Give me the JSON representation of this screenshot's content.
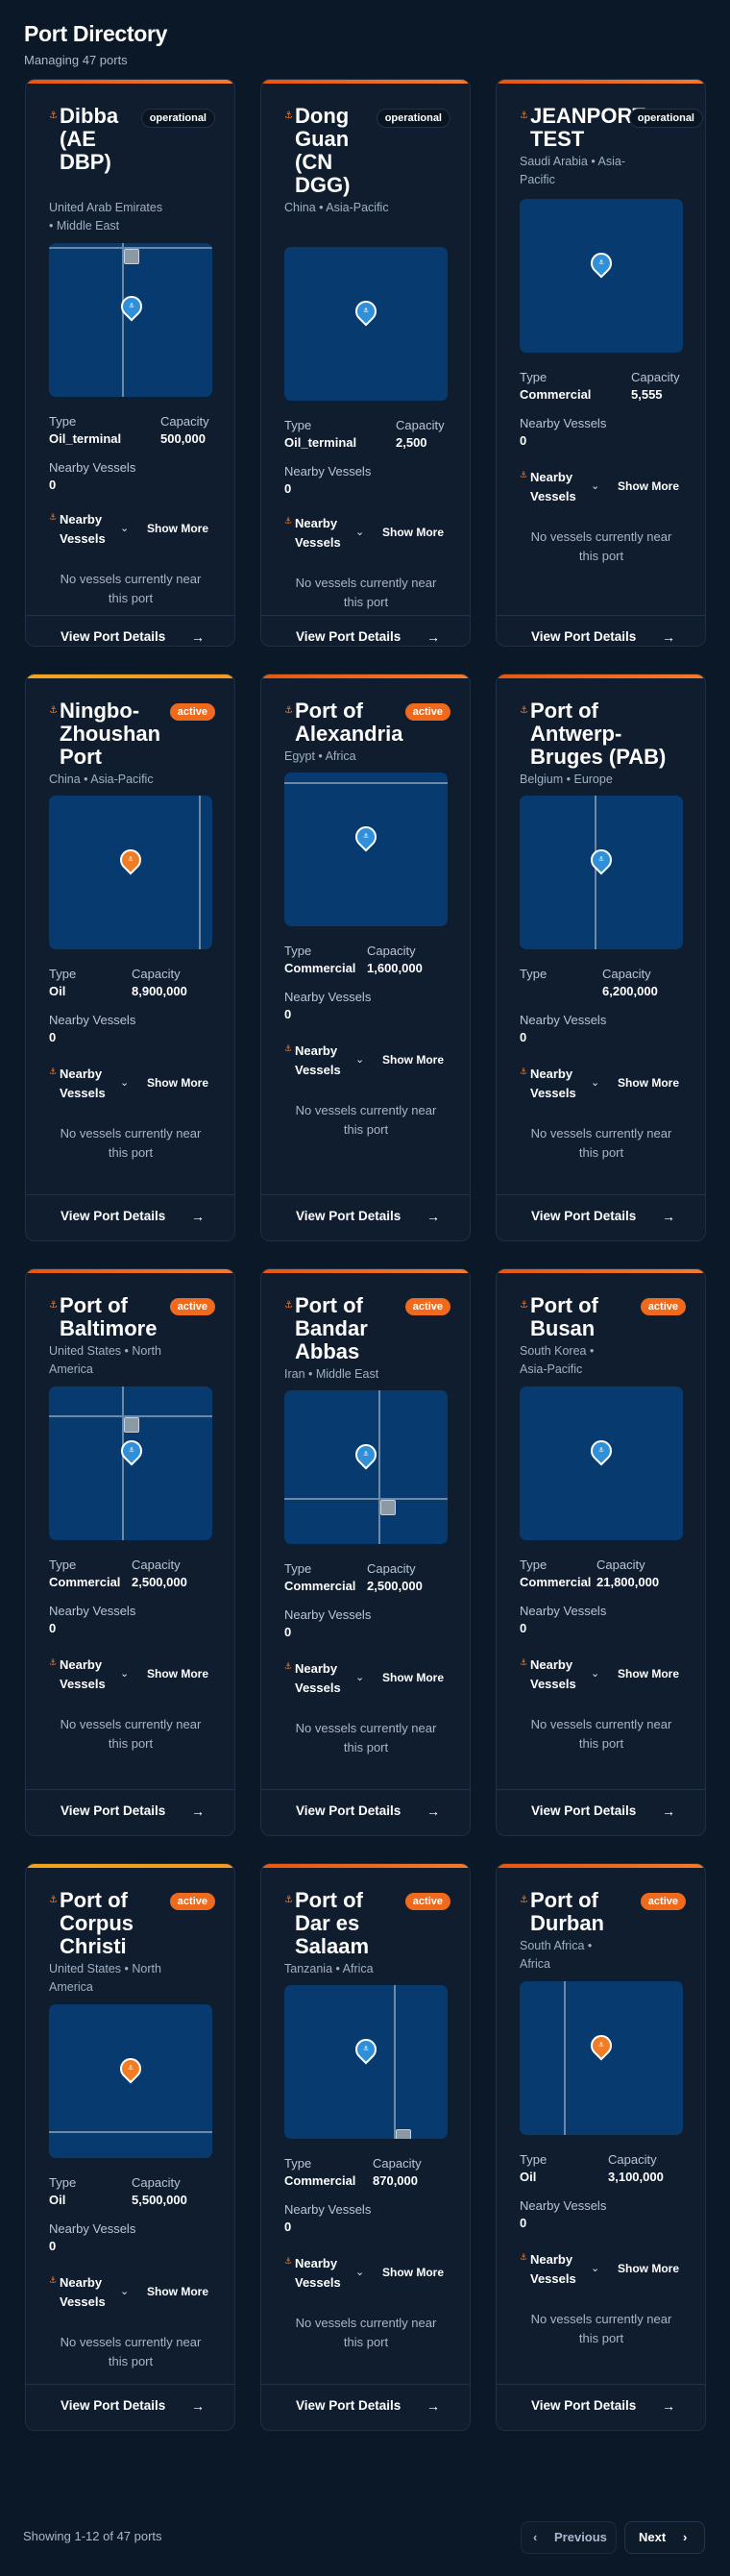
{
  "header": {
    "title": "Port Directory",
    "subtitle": "Managing 47 ports"
  },
  "labels": {
    "type": "Type",
    "capacity": "Capacity",
    "nearby_vessels": "Nearby Vessels",
    "nearby_vessels_toggle": "Nearby Vessels",
    "show_more": "Show More",
    "no_vessels": "No vessels currently near this port",
    "view_details": "View Port Details"
  },
  "ports": [
    {
      "name": "Dibba (AE DBP)",
      "location": "United Arab Emirates • Middle East",
      "status": "operational",
      "type": "Oil_terminal",
      "capacity": "500,000",
      "nearby_count": "0"
    },
    {
      "name": "Dong Guan (CN DGG)",
      "location": "China • Asia-Pacific",
      "status": "operational",
      "type": "Oil_terminal",
      "capacity": "2,500",
      "nearby_count": "0"
    },
    {
      "name": "JEANPORT TEST",
      "location": "Saudi Arabia • Asia-Pacific",
      "status": "operational",
      "type": "Commercial",
      "capacity": "5,555",
      "nearby_count": "0"
    },
    {
      "name": "Ningbo-Zhoushan Port",
      "location": "China • Asia-Pacific",
      "status": "active",
      "type": "Oil",
      "capacity": "8,900,000",
      "nearby_count": "0"
    },
    {
      "name": "Port of Alexandria",
      "location": "Egypt • Africa",
      "status": "active",
      "type": "Commercial",
      "capacity": "1,600,000",
      "nearby_count": "0"
    },
    {
      "name": "Port of Antwerp-Bruges (PAB)",
      "location": "Belgium • Europe",
      "status": "",
      "type": "",
      "capacity": "6,200,000",
      "nearby_count": "0"
    },
    {
      "name": "Port of Baltimore",
      "location": "United States • North America",
      "status": "active",
      "type": "Commercial",
      "capacity": "2,500,000",
      "nearby_count": "0"
    },
    {
      "name": "Port of Bandar Abbas",
      "location": "Iran • Middle East",
      "status": "active",
      "type": "Commercial",
      "capacity": "2,500,000",
      "nearby_count": "0"
    },
    {
      "name": "Port of Busan",
      "location": "South Korea • Asia-Pacific",
      "status": "active",
      "type": "Commercial",
      "capacity": "21,800,000",
      "nearby_count": "0"
    },
    {
      "name": "Port of Corpus Christi",
      "location": "United States • North America",
      "status": "active",
      "type": "Oil",
      "capacity": "5,500,000",
      "nearby_count": "0"
    },
    {
      "name": "Port of Dar es Salaam",
      "location": "Tanzania • Africa",
      "status": "active",
      "type": "Commercial",
      "capacity": "870,000",
      "nearby_count": "0"
    },
    {
      "name": "Port of Durban",
      "location": "South Africa • Africa",
      "status": "active",
      "type": "Oil",
      "capacity": "3,100,000",
      "nearby_count": "0"
    }
  ],
  "pagination": {
    "summary": "Showing 1-12 of 47 ports",
    "previous": "Previous",
    "next": "Next"
  },
  "icons": {
    "anchor": "anchor-icon",
    "map_pin": "map-pin-icon",
    "chevron": "chevron-down-icon",
    "arrow": "arrow-right-icon"
  },
  "colors": {
    "accent": "#ef6a1c",
    "map": "#073a6f",
    "background": "#0b1827"
  }
}
